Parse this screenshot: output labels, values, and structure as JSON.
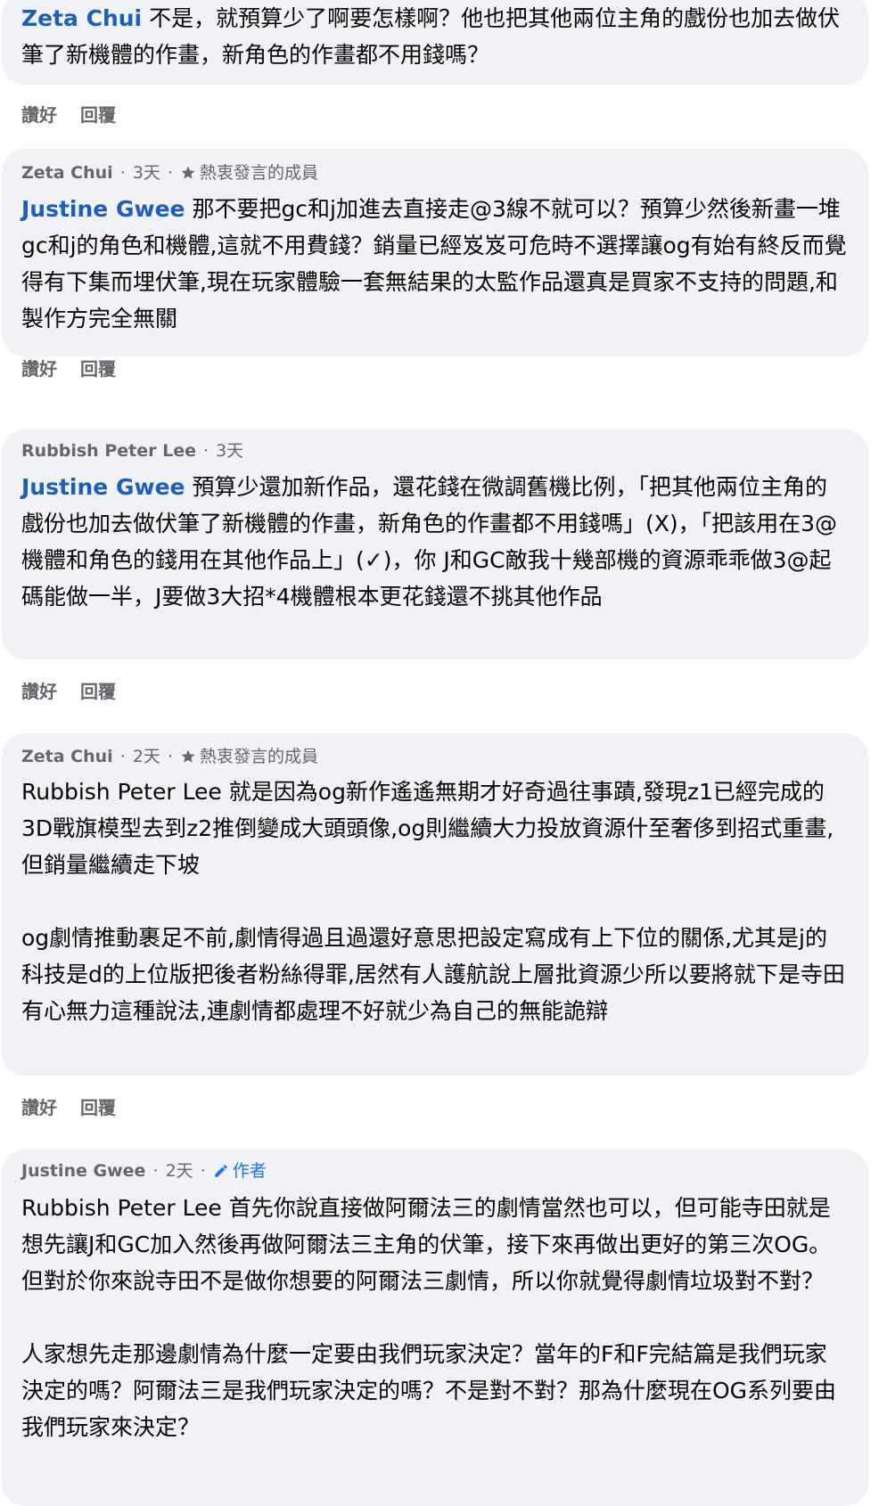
{
  "actions": {
    "like": "讚好",
    "reply": "回覆"
  },
  "comments": [
    {
      "mention": "Zeta Chui",
      "text": "不是，就預算少了啊要怎樣啊？他也把其他兩位主角的戲份也加去做伏筆了新機體的作畫，新角色的作畫都不用錢嗎？"
    },
    {
      "author": "Zeta Chui",
      "time": "3天",
      "role": "熱衷發言的成員",
      "mention": "Justine Gwee",
      "text": "那不要把gc和j加進去直接走@3線不就可以？預算少然後新畫一堆gc和j的角色和機體,這就不用費錢？銷量已經岌岌可危時不選擇讓og有始有終反而覺得有下集而埋伏筆,現在玩家體驗一套無結果的太監作品還真是買家不支持的問題,和製作方完全無關"
    },
    {
      "author": "Rubbish Peter Lee",
      "time": "3天",
      "mention": "Justine Gwee",
      "text": "預算少還加新作品，還花錢在微調舊機比例，「把其他兩位主角的戲份也加去做伏筆了新機體的作畫，新角色的作畫都不用錢嗎」(X)，「把該用在3@機體和角色的錢用在其他作品上」(✓)，你 J和GC敵我十幾部機的資源乖乖做3@起碼能做一半，J要做3大招*4機體根本更花錢還不挑其他作品"
    },
    {
      "author": "Zeta Chui",
      "time": "2天",
      "role": "熱衷發言的成員",
      "mention": "Rubbish Peter Lee",
      "text": "就是因為og新作遙遙無期才好奇過往事蹟,發現z1已經完成的3D戰旗模型去到z2推倒變成大頭頭像,og則繼續大力投放資源什至奢侈到招式重畫,但銷量繼續走下坡",
      "text2": "og劇情推動裹足不前,劇情得過且過還好意思把設定寫成有上下位的關係,尤其是j的科技是d的上位版把後者粉絲得罪,居然有人護航說上層批資源少所以要將就下是寺田有心無力這種說法,連劇情都處理不好就少為自己的無能詭辯"
    },
    {
      "author": "Justine Gwee",
      "time": "2天",
      "role": "作者",
      "mention": "Rubbish Peter Lee",
      "text": "首先你說直接做阿爾法三的劇情當然也可以，但可能寺田就是想先讓J和GC加入然後再做阿爾法三主角的伏筆，接下來再做出更好的第三次OG。但對於你來說寺田不是做你想要的阿爾法三劇情，所以你就覺得劇情垃圾對不對？",
      "text2": "人家想先走那邊劇情為什麼一定要由我們玩家決定？當年的F和F完結篇是我們玩家決定的嗎？阿爾法三是我們玩家決定的嗎？不是對不對？那為什麼現在OG系列要由我們玩家來決定？"
    }
  ]
}
